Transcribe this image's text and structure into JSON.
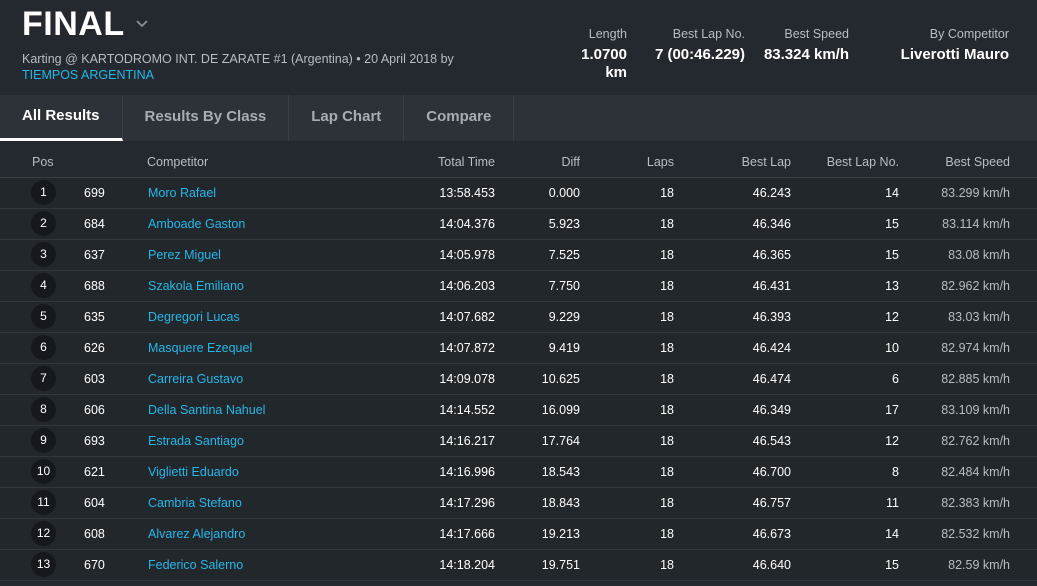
{
  "header": {
    "title": "FINAL",
    "subtitle_line1": "Karting @ KARTODROMO INT. DE ZARATE #1 (Argentina) • 20 April 2018 by",
    "subtitle_link": "TIEMPOS ARGENTINA",
    "stats": [
      {
        "label": "Length",
        "value": "1.0700 km"
      },
      {
        "label": "Best Lap No.",
        "value": "7 (00:46.229)"
      },
      {
        "label": "Best Speed",
        "value": "83.324 km/h"
      },
      {
        "label": "By Competitor",
        "value": "Liverotti Mauro"
      }
    ]
  },
  "tabs": [
    {
      "label": "All Results",
      "active": true
    },
    {
      "label": "Results By Class",
      "active": false
    },
    {
      "label": "Lap Chart",
      "active": false
    },
    {
      "label": "Compare",
      "active": false
    }
  ],
  "table": {
    "columns": {
      "pos": "Pos",
      "competitor": "Competitor",
      "total": "Total Time",
      "diff": "Diff",
      "laps": "Laps",
      "best": "Best Lap",
      "best_no": "Best Lap No.",
      "speed": "Best Speed"
    },
    "rows": [
      {
        "pos": "1",
        "num": "699",
        "name": "Moro Rafael",
        "total": "13:58.453",
        "diff": "0.000",
        "laps": "18",
        "best": "46.243",
        "best_no": "14",
        "speed": "83.299 km/h"
      },
      {
        "pos": "2",
        "num": "684",
        "name": "Amboade Gaston",
        "total": "14:04.376",
        "diff": "5.923",
        "laps": "18",
        "best": "46.346",
        "best_no": "15",
        "speed": "83.114 km/h"
      },
      {
        "pos": "3",
        "num": "637",
        "name": "Perez Miguel",
        "total": "14:05.978",
        "diff": "7.525",
        "laps": "18",
        "best": "46.365",
        "best_no": "15",
        "speed": "83.08 km/h"
      },
      {
        "pos": "4",
        "num": "688",
        "name": "Szakola Emiliano",
        "total": "14:06.203",
        "diff": "7.750",
        "laps": "18",
        "best": "46.431",
        "best_no": "13",
        "speed": "82.962 km/h"
      },
      {
        "pos": "5",
        "num": "635",
        "name": "Degregori Lucas",
        "total": "14:07.682",
        "diff": "9.229",
        "laps": "18",
        "best": "46.393",
        "best_no": "12",
        "speed": "83.03 km/h"
      },
      {
        "pos": "6",
        "num": "626",
        "name": "Masquere Ezequel",
        "total": "14:07.872",
        "diff": "9.419",
        "laps": "18",
        "best": "46.424",
        "best_no": "10",
        "speed": "82.974 km/h"
      },
      {
        "pos": "7",
        "num": "603",
        "name": "Carreira Gustavo",
        "total": "14:09.078",
        "diff": "10.625",
        "laps": "18",
        "best": "46.474",
        "best_no": "6",
        "speed": "82.885 km/h"
      },
      {
        "pos": "8",
        "num": "606",
        "name": "Della Santina Nahuel",
        "total": "14:14.552",
        "diff": "16.099",
        "laps": "18",
        "best": "46.349",
        "best_no": "17",
        "speed": "83.109 km/h"
      },
      {
        "pos": "9",
        "num": "693",
        "name": "Estrada Santiago",
        "total": "14:16.217",
        "diff": "17.764",
        "laps": "18",
        "best": "46.543",
        "best_no": "12",
        "speed": "82.762 km/h"
      },
      {
        "pos": "10",
        "num": "621",
        "name": "Viglietti Eduardo",
        "total": "14:16.996",
        "diff": "18.543",
        "laps": "18",
        "best": "46.700",
        "best_no": "8",
        "speed": "82.484 km/h"
      },
      {
        "pos": "11",
        "num": "604",
        "name": "Cambria Stefano",
        "total": "14:17.296",
        "diff": "18.843",
        "laps": "18",
        "best": "46.757",
        "best_no": "11",
        "speed": "82.383 km/h"
      },
      {
        "pos": "12",
        "num": "608",
        "name": "Alvarez Alejandro",
        "total": "14:17.666",
        "diff": "19.213",
        "laps": "18",
        "best": "46.673",
        "best_no": "14",
        "speed": "82.532 km/h"
      },
      {
        "pos": "13",
        "num": "670",
        "name": "Federico Salerno",
        "total": "14:18.204",
        "diff": "19.751",
        "laps": "18",
        "best": "46.640",
        "best_no": "15",
        "speed": "82.59 km/h"
      }
    ]
  },
  "colors": {
    "background": "#24292f",
    "link": "#27b7e8",
    "badge": "#15191d"
  }
}
